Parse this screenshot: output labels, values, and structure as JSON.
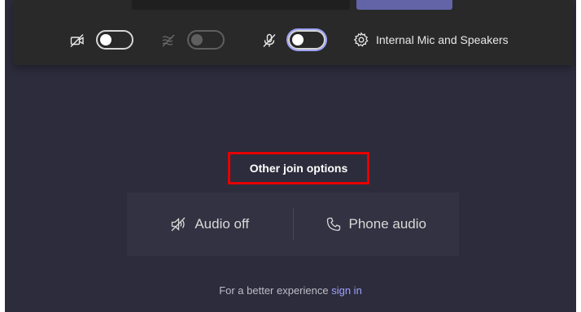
{
  "controls": {
    "video_icon": "video-off-icon",
    "blur_icon": "background-blur-icon",
    "mic_icon": "mic-off-icon",
    "settings_icon": "gear-icon",
    "device_label": "Internal Mic and Speakers"
  },
  "join_options": {
    "title": "Other join options",
    "audio_off_label": "Audio off",
    "phone_audio_label": "Phone audio"
  },
  "footer": {
    "text": "For a better experience",
    "link_label": "sign in"
  },
  "colors": {
    "background": "#2d2c3c",
    "panel": "#292929",
    "accent": "#6264a7",
    "link": "#9ea2ff",
    "highlight_box": "#e60000"
  }
}
